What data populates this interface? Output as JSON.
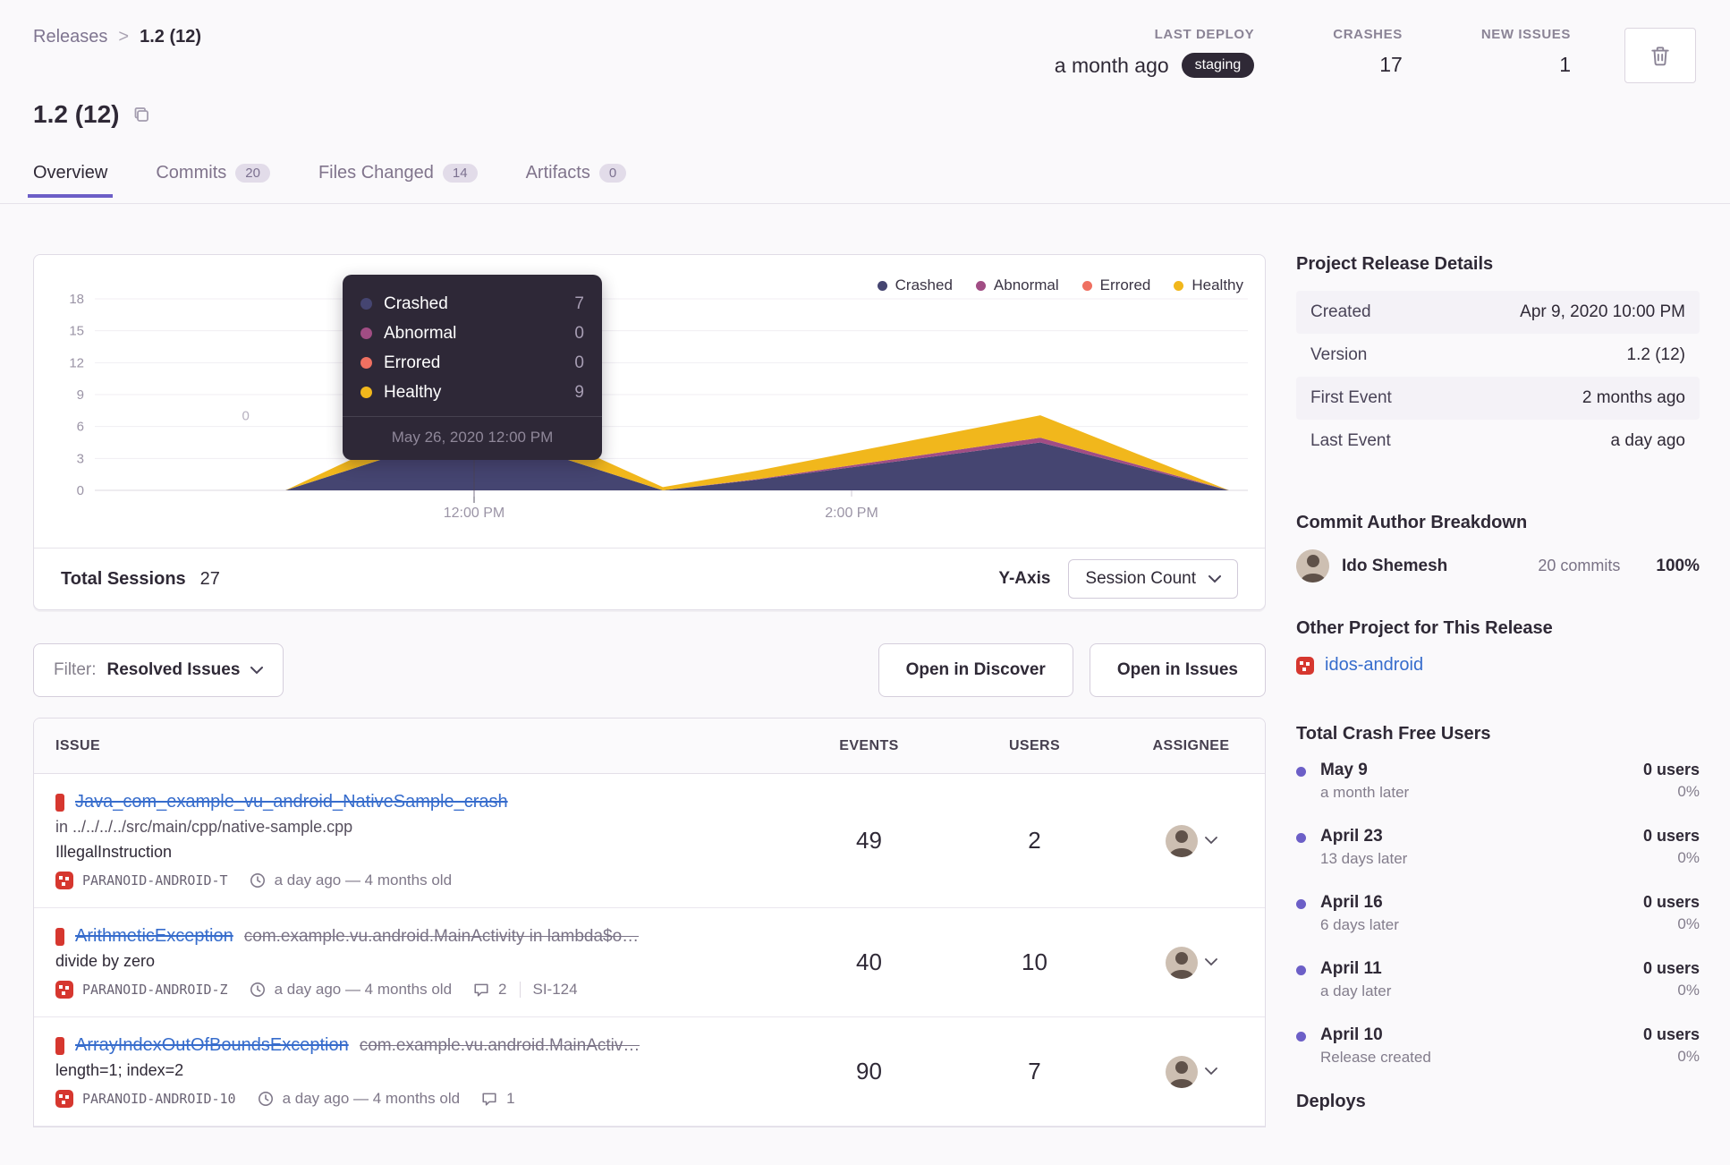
{
  "colors": {
    "accent": "#6c5fc7",
    "link": "#366ccc",
    "error_level": "#d6372f",
    "env_badge": "#2f2936"
  },
  "breadcrumb": {
    "parent": "Releases",
    "separator": ">",
    "current": "1.2 (12)"
  },
  "header_stats": {
    "last_deploy": {
      "label": "LAST DEPLOY",
      "value": "a month ago",
      "environment": "staging"
    },
    "crashes": {
      "label": "CRASHES",
      "value": "17"
    },
    "new_issues": {
      "label": "NEW ISSUES",
      "value": "1"
    }
  },
  "page_title": "1.2 (12)",
  "tabs": [
    {
      "label": "Overview"
    },
    {
      "label": "Commits",
      "count": "20"
    },
    {
      "label": "Files Changed",
      "count": "14"
    },
    {
      "label": "Artifacts",
      "count": "0"
    }
  ],
  "chart_data": {
    "type": "area",
    "stacked": true,
    "title": "Release sessions over time",
    "x_unit": "hour_of_day",
    "x": [
      11.0,
      12.0,
      13.0,
      13.5,
      15.0,
      16.0
    ],
    "series": [
      {
        "name": "Crashed",
        "color": "#454571",
        "values": [
          0,
          5.7,
          0,
          1.0,
          4.5,
          0
        ]
      },
      {
        "name": "Abnormal",
        "color": "#a14d84",
        "values": [
          0,
          0,
          0,
          0.05,
          0.45,
          0
        ]
      },
      {
        "name": "Errored",
        "color": "#ef7061",
        "values": [
          0,
          0,
          0,
          0,
          0,
          0
        ]
      },
      {
        "name": "Healthy",
        "color": "#f1b71c",
        "values": [
          0,
          2.6,
          0.3,
          0.8,
          2.1,
          0
        ]
      }
    ],
    "ylim": [
      0,
      18
    ],
    "xlim": [
      10.0,
      16.1
    ],
    "y_ticks": [
      0,
      3,
      6,
      9,
      12,
      15,
      18
    ],
    "x_ticks": [
      {
        "t": 12,
        "label": "12:00 PM"
      },
      {
        "t": 14,
        "label": "2:00 PM"
      }
    ],
    "grid": true,
    "legend_position": "top-right",
    "point_label": {
      "t": 10.79,
      "v": 6.6,
      "text": "0"
    },
    "guide_t": 12
  },
  "chart": {
    "tooltip": {
      "rows": [
        {
          "label": "Crashed",
          "value": "7"
        },
        {
          "label": "Abnormal",
          "value": "0"
        },
        {
          "label": "Errored",
          "value": "0"
        },
        {
          "label": "Healthy",
          "value": "9"
        }
      ],
      "timestamp": "May 26, 2020 12:00 PM"
    },
    "footer": {
      "total_sessions_label": "Total Sessions",
      "total_sessions_value": "27",
      "y_axis_label": "Y-Axis",
      "y_axis_selected": "Session Count"
    }
  },
  "filter_bar": {
    "label": "Filter:",
    "selected": "Resolved Issues",
    "open_in_discover": "Open in Discover",
    "open_in_issues": "Open in Issues"
  },
  "issues_table": {
    "columns": {
      "issue": "ISSUE",
      "events": "EVENTS",
      "users": "USERS",
      "assignee": "ASSIGNEE"
    },
    "rows": [
      {
        "title": "Java_com_example_vu_android_NativeSample_crash",
        "culprit": "in ../../../../src/main/cpp/native-sample.cpp",
        "message": "IllegalInstruction",
        "project": "PARANOID-ANDROID-T",
        "age": "a day ago — 4 months old",
        "events": "49",
        "users": "2"
      },
      {
        "title": "ArithmeticException",
        "subtitle": "com.example.vu.android.MainActivity in lambda$o…",
        "message": "divide by zero",
        "project": "PARANOID-ANDROID-Z",
        "age": "a day ago — 4 months old",
        "comments": "2",
        "annotation": "SI-124",
        "events": "40",
        "users": "10"
      },
      {
        "title": "ArrayIndexOutOfBoundsException",
        "subtitle": "com.example.vu.android.MainActiv…",
        "message": "length=1; index=2",
        "project": "PARANOID-ANDROID-10",
        "age": "a day ago — 4 months old",
        "comments": "1",
        "events": "90",
        "users": "7"
      }
    ]
  },
  "sidebar": {
    "release_details": {
      "title": "Project Release Details",
      "rows": [
        {
          "label": "Created",
          "value": "Apr 9, 2020 10:00 PM"
        },
        {
          "label": "Version",
          "value": "1.2 (12)"
        },
        {
          "label": "First Event",
          "value": "2 months ago"
        },
        {
          "label": "Last Event",
          "value": "a day ago"
        }
      ]
    },
    "commit_authors": {
      "title": "Commit Author Breakdown",
      "author": {
        "name": "Ido Shemesh",
        "commits": "20 commits",
        "percent": "100%"
      }
    },
    "other_projects": {
      "title": "Other Project for This Release",
      "link": "idos-android"
    },
    "crash_free": {
      "title": "Total Crash Free Users",
      "entries": [
        {
          "date": "May 9",
          "note": "a month later",
          "users": "0 users",
          "percent": "0%"
        },
        {
          "date": "April 23",
          "note": "13 days later",
          "users": "0 users",
          "percent": "0%"
        },
        {
          "date": "April 16",
          "note": "6 days later",
          "users": "0 users",
          "percent": "0%"
        },
        {
          "date": "April 11",
          "note": "a day later",
          "users": "0 users",
          "percent": "0%"
        },
        {
          "date": "April 10",
          "note": "Release created",
          "users": "0 users",
          "percent": "0%"
        }
      ]
    },
    "deploys_title": "Deploys"
  }
}
